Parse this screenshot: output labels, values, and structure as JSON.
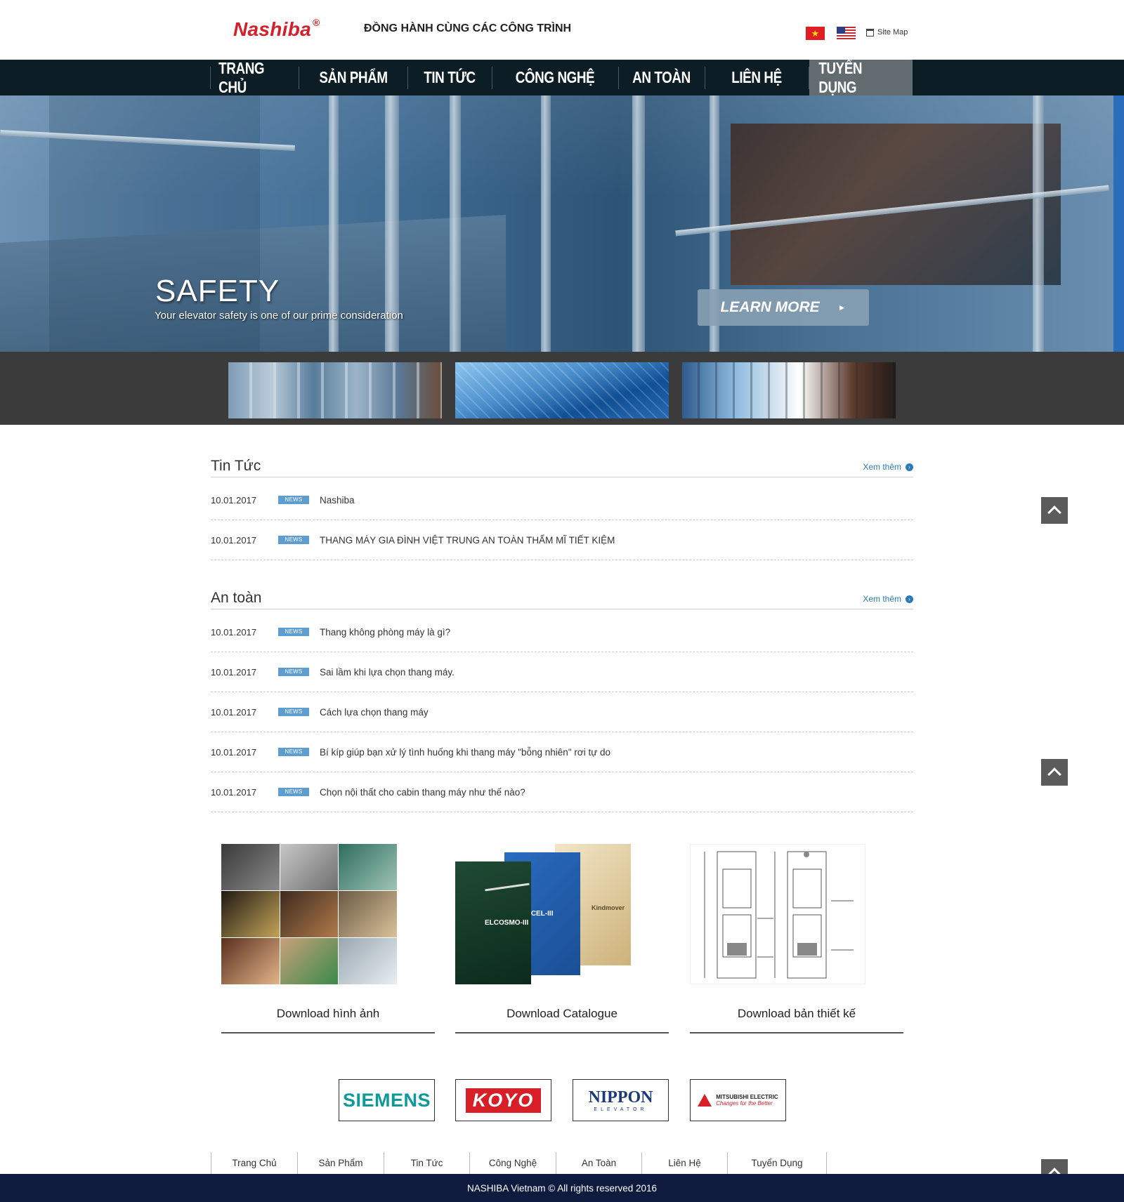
{
  "header": {
    "logo": "Nashiba",
    "logo_mark": "®",
    "slogan": "ĐỒNG HÀNH CÙNG CÁC CÔNG TRÌNH",
    "lang_vi_icon": "vietnam-flag-icon",
    "lang_en_icon": "us-flag-icon",
    "sitemap_label": "Site Map"
  },
  "nav": {
    "items": [
      "TRANG CHỦ",
      "SẢN PHẨM",
      "TIN TỨC",
      "CÔNG NGHỆ",
      "AN TOÀN",
      "LIÊN HỆ",
      "TUYỂN DỤNG"
    ],
    "active": "TUYỂN DỤNG"
  },
  "hero": {
    "title": "SAFETY",
    "subtitle": "Your elevator safety is one of our prime consideration",
    "cta": "LEARN MORE",
    "cta_arrow": "►"
  },
  "news_section": {
    "title": "Tin Tức",
    "see_more": "Xem thêm",
    "items": [
      {
        "date": "10.01.2017",
        "badge": "NEWS",
        "title": "Nashiba"
      },
      {
        "date": "10.01.2017",
        "badge": "NEWS",
        "title": "THANG MÁY GIA ĐÌNH VIỆT TRUNG AN TOÀN THẨM MĨ TIẾT KIỆM"
      }
    ]
  },
  "safety_section": {
    "title": "An toàn",
    "see_more": "Xem thêm",
    "items": [
      {
        "date": "10.01.2017",
        "badge": "NEWS",
        "title": "Thang không phòng máy là gì?"
      },
      {
        "date": "10.01.2017",
        "badge": "NEWS",
        "title": "Sai lầm khi lựa chọn thang máy."
      },
      {
        "date": "10.01.2017",
        "badge": "NEWS",
        "title": "Cách lựa chọn thang máy"
      },
      {
        "date": "10.01.2017",
        "badge": "NEWS",
        "title": "Bí kíp giúp bạn xử lý tình huống khi thang máy \"bỗng nhiên\" rơi tự do"
      },
      {
        "date": "10.01.2017",
        "badge": "NEWS",
        "title": "Chọn nội thất cho cabin thang máy như thế nào?"
      }
    ]
  },
  "downloads": {
    "images": "Download hình ảnh",
    "catalogue": "Download Catalogue",
    "design": "Download bản thiết kế",
    "brochure_1": "ELCOSMO-III",
    "brochure_2": "SPACEL-III",
    "brochure_3": "Kindmover"
  },
  "partners": {
    "siemens": "SIEMENS",
    "koyo": "KOYO",
    "nippon": "NIPPON",
    "nippon_sub": "ELEVATOR",
    "mitsubishi": "MITSUBISHI ELECTRIC",
    "mitsubishi_tagline": "Changes for the Better"
  },
  "footer_nav": [
    "Trang Chủ",
    "Sản Phẩm",
    "Tin Tức",
    "Công Nghệ",
    "An Toàn",
    "Liên Hệ",
    "Tuyển Dụng"
  ],
  "footer": {
    "copyright": "NASHIBA Vietnam © All rights reserved 2016"
  },
  "colors": {
    "brand_red": "#d4202a",
    "nav_bg": "#0d1d26",
    "nav_active": "#626b70",
    "link_blue": "#2c7ab5",
    "badge_blue": "#5e9dd0",
    "footer_bg": "#0e1a3e"
  }
}
